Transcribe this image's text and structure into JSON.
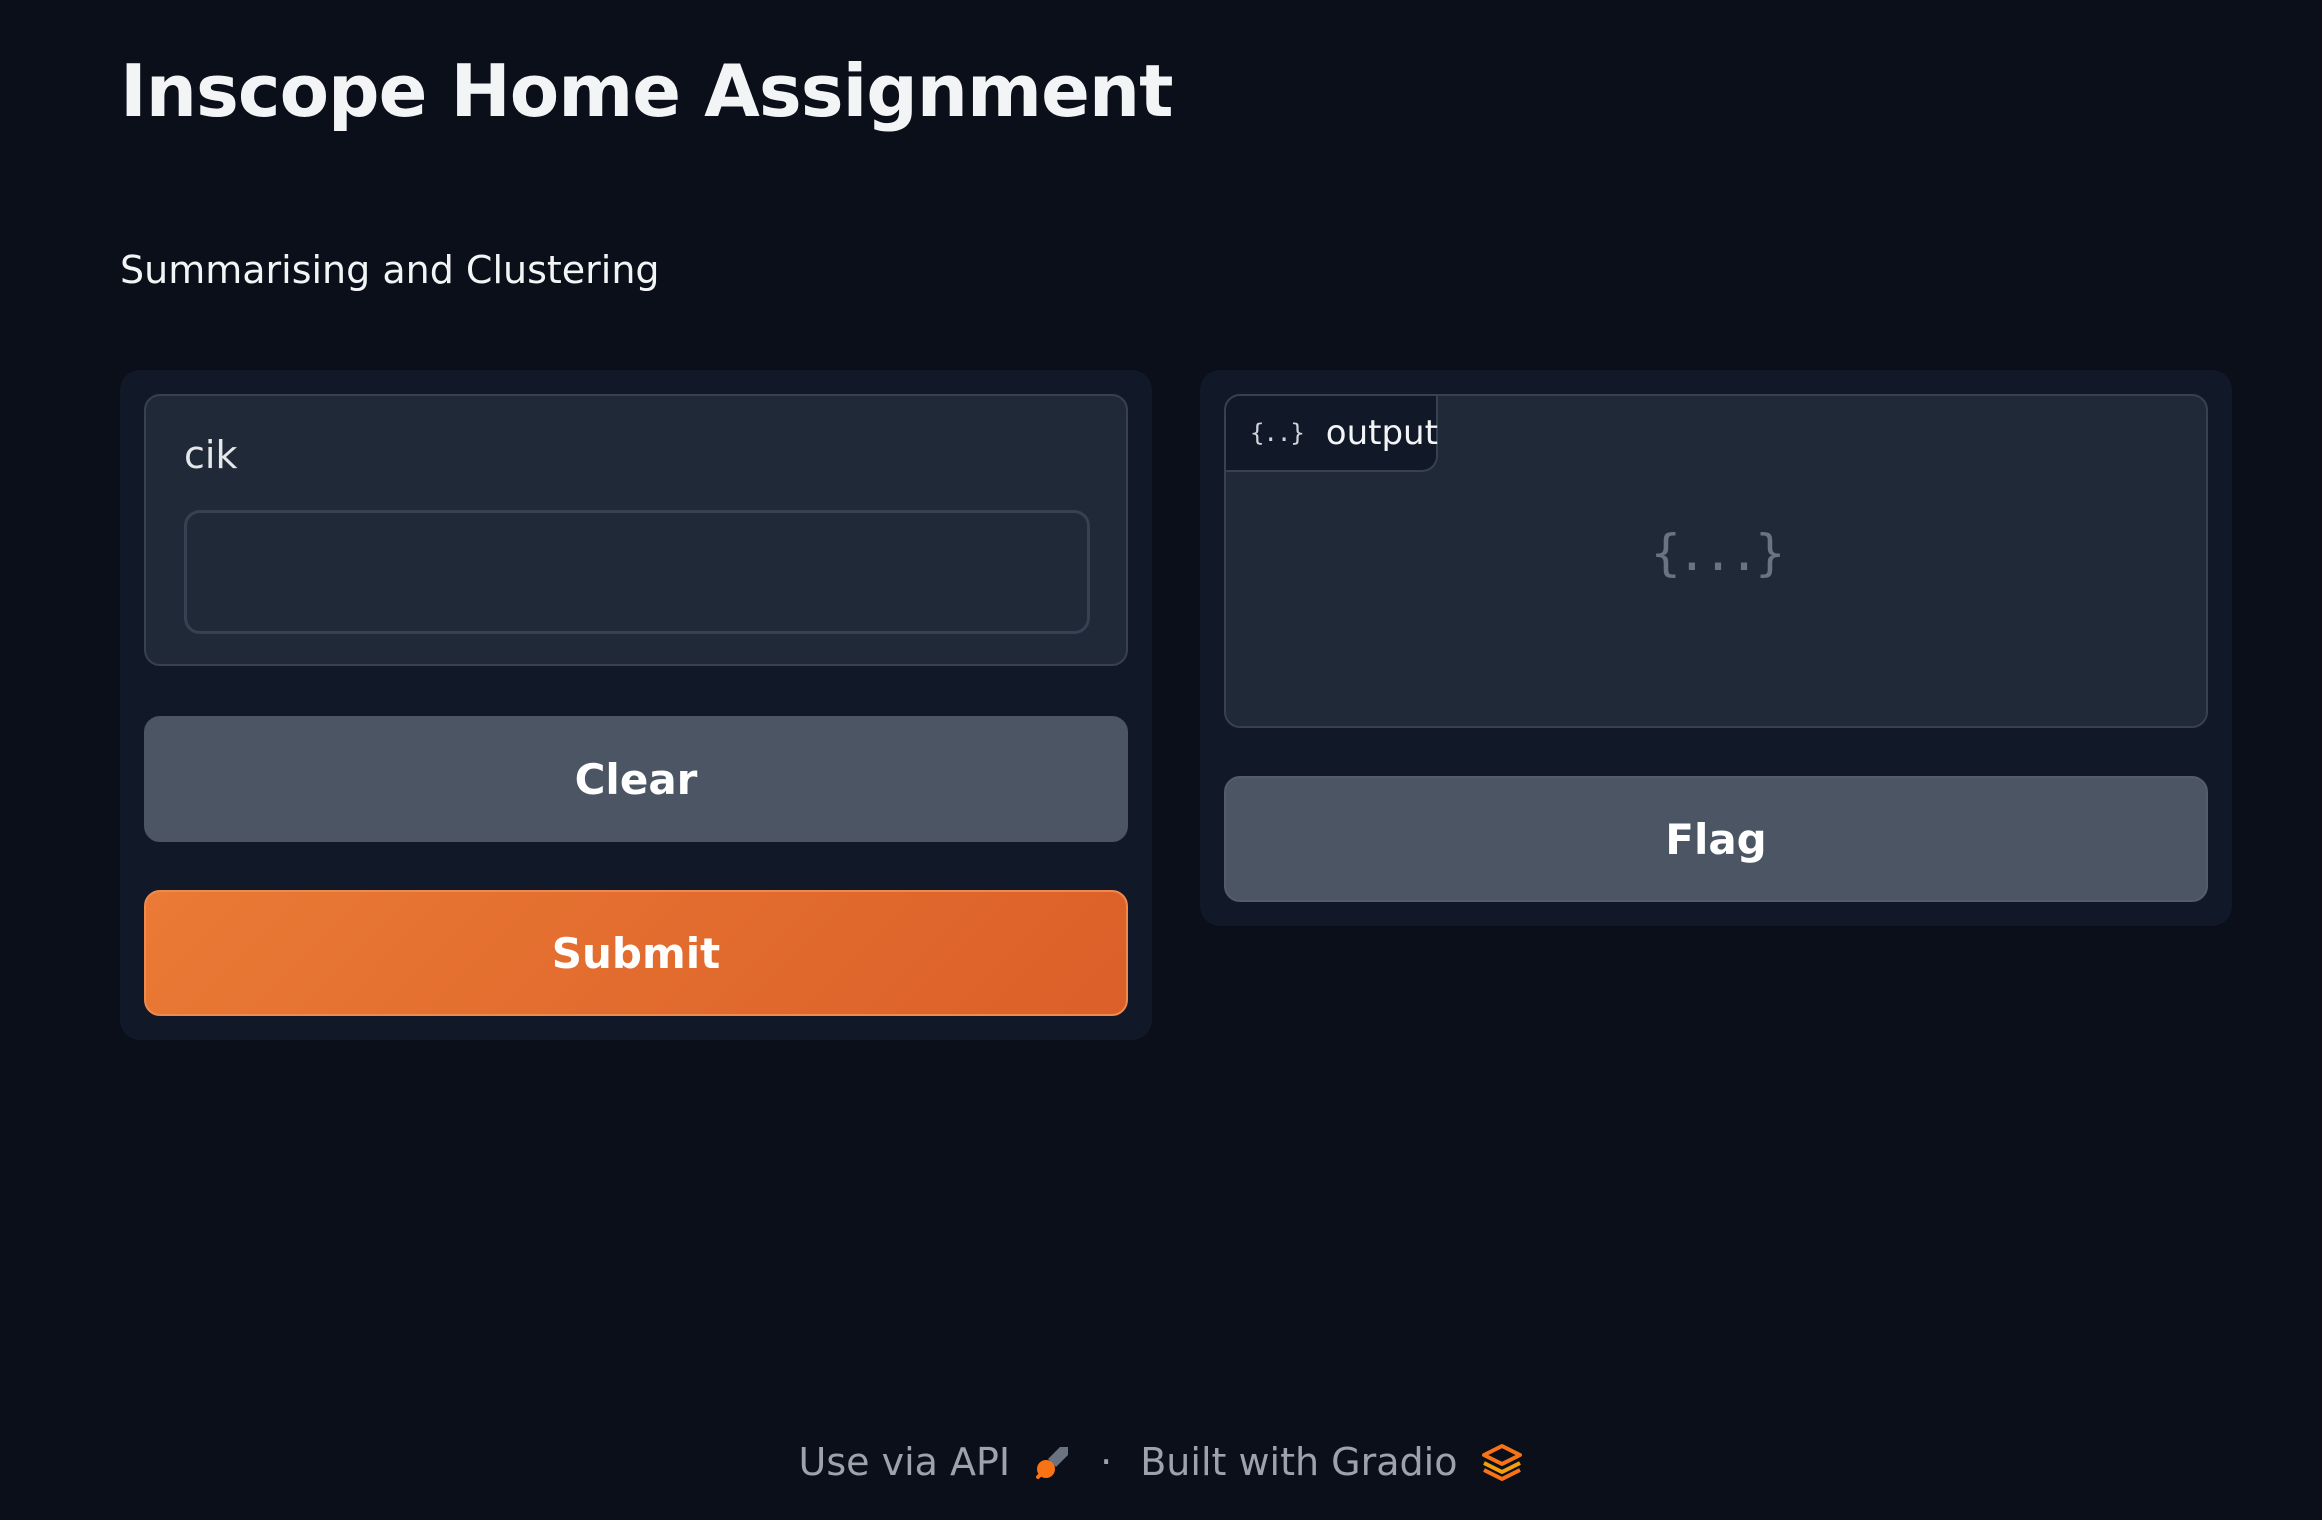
{
  "header": {
    "title": "Inscope Home Assignment",
    "description": "Summarising and Clustering"
  },
  "input": {
    "label": "cik",
    "value": "",
    "placeholder": ""
  },
  "buttons": {
    "clear_label": "Clear",
    "submit_label": "Submit",
    "flag_label": "Flag"
  },
  "output": {
    "tab_icon": "{..}",
    "tab_label": "output",
    "empty_icon": "{...}"
  },
  "footer": {
    "api_label": "Use via API",
    "separator": "·",
    "built_label": "Built with Gradio"
  },
  "colors": {
    "background": "#0b0f19",
    "panel": "#111827",
    "block": "#1f2937",
    "secondary_button": "#4b5563",
    "primary_button": "#e5692f"
  },
  "icons": {
    "api": "rocket-icon",
    "gradio": "gradio-logo-icon",
    "json": "json-braces-icon"
  }
}
